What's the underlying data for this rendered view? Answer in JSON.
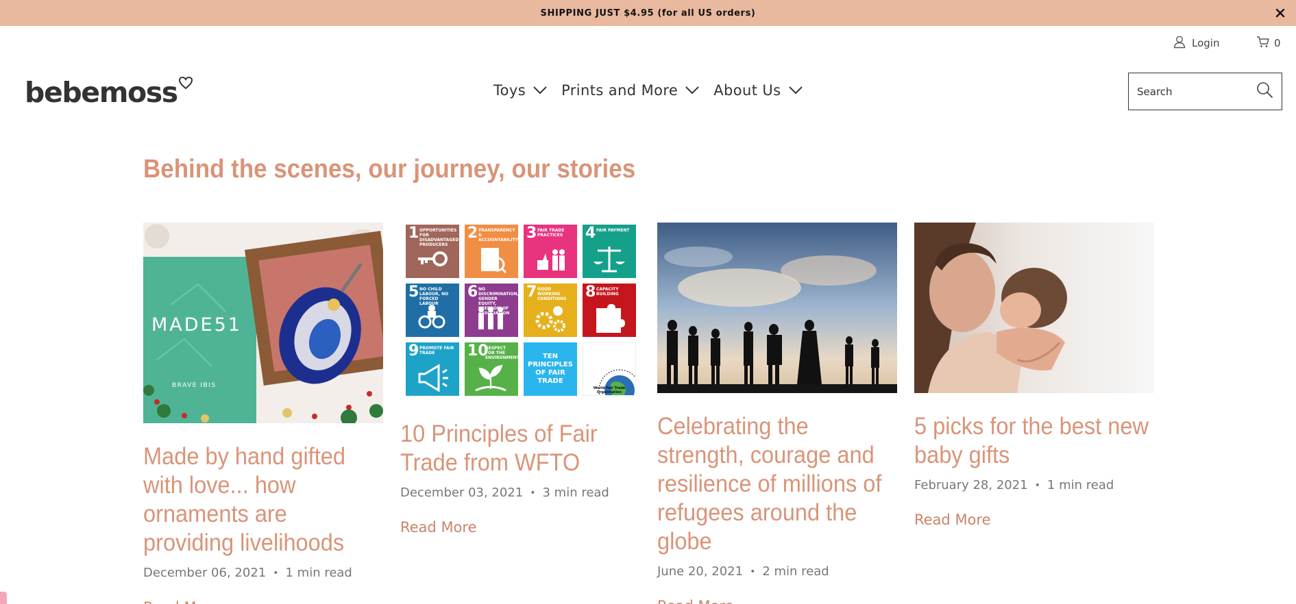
{
  "announcement": {
    "text": "SHIPPING JUST $4.95 (for all US orders)"
  },
  "header": {
    "logo_text": "bebemoss",
    "login_label": "Login",
    "cart_count": "0",
    "nav": [
      {
        "label": "Toys"
      },
      {
        "label": "Prints and More"
      },
      {
        "label": "About Us"
      }
    ],
    "search_placeholder": "Search"
  },
  "main": {
    "headline": "Behind the scenes, our journey, our stories",
    "read_more_label": "Read More",
    "articles": [
      {
        "title": "Made by hand gifted with love... how ornaments are providing livelihoods",
        "date": "December 06, 2021",
        "read_time": "1 min read",
        "image_text": "MADE51",
        "image_subtext": "BRAVE IBIS"
      },
      {
        "title": "10 Principles of Fair Trade from WFTO",
        "date": "December 03, 2021",
        "read_time": "3 min read"
      },
      {
        "title": "Celebrating the strength, courage and resilience of millions of refugees around the globe",
        "date": "June 20, 2021",
        "read_time": "2 min read"
      },
      {
        "title": "5 picks for the best new baby gifts",
        "date": "February 28, 2021",
        "read_time": "1 min read"
      }
    ],
    "fair_trade_tiles": [
      {
        "num": "1",
        "label": "Opportunities for disadvantaged producers",
        "color": "#a0665a",
        "icon": "key-icon"
      },
      {
        "num": "2",
        "label": "Transparency & accountability",
        "color": "#f08e45",
        "icon": "document-icon"
      },
      {
        "num": "3",
        "label": "Fair trade practices",
        "color": "#e8337f",
        "icon": "people-icon"
      },
      {
        "num": "4",
        "label": "Fair payment",
        "color": "#15a08a",
        "icon": "scale-icon"
      },
      {
        "num": "5",
        "label": "No child labour, no forced labour",
        "color": "#1f6fa6",
        "icon": "chain-icon"
      },
      {
        "num": "6",
        "label": "No discrimination, gender equity, freedom of association",
        "color": "#8d3c8e",
        "icon": "group-icon"
      },
      {
        "num": "7",
        "label": "Good working conditions",
        "color": "#e5b01c",
        "icon": "gear-icon"
      },
      {
        "num": "8",
        "label": "Capacity building",
        "color": "#c4161c",
        "icon": "puzzle-icon"
      },
      {
        "num": "9",
        "label": "Promote fair trade",
        "color": "#1ea3c8",
        "icon": "megaphone-icon"
      },
      {
        "num": "10",
        "label": "Respect for the environment",
        "color": "#56b248",
        "icon": "plant-icon"
      },
      {
        "num": "",
        "label": "Ten principles of fair trade",
        "color": "#2bb5ee",
        "icon": "text-tile"
      },
      {
        "num": "",
        "label": "World Fair Trade Organization",
        "color": "#ffffff",
        "icon": "wfto-logo"
      }
    ]
  },
  "colors": {
    "accent": "#d99478",
    "banner": "#e8b99e",
    "text": "#333333"
  }
}
